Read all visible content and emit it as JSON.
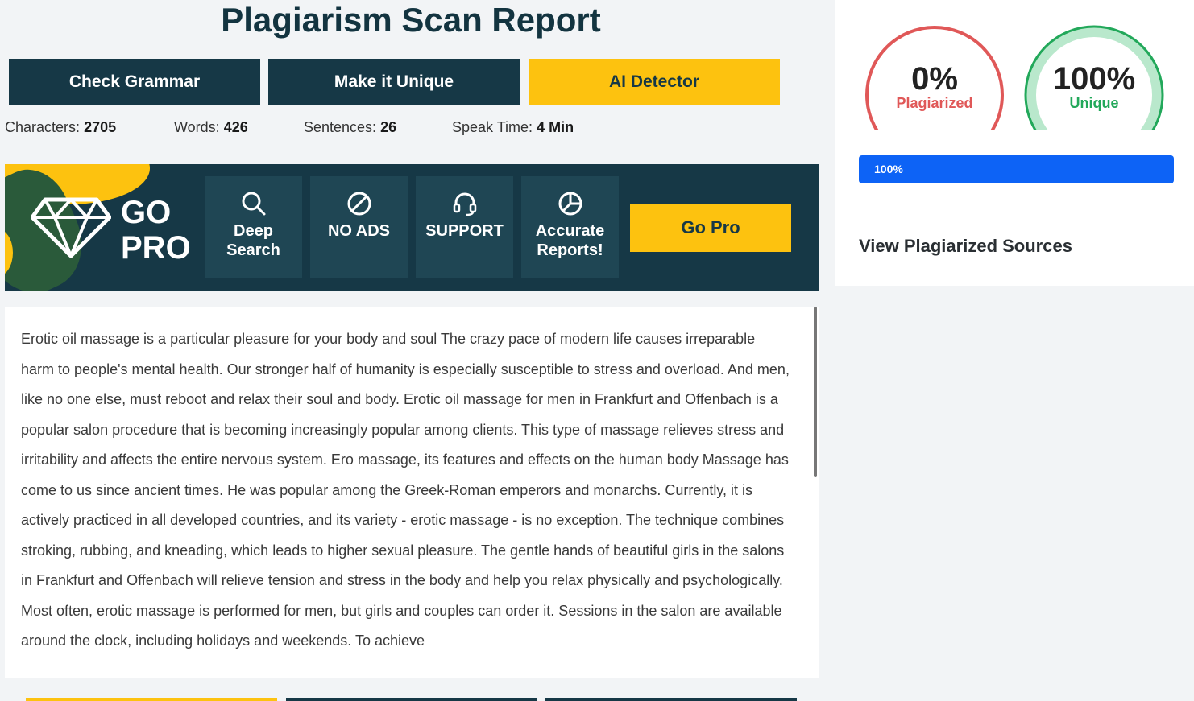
{
  "header": {
    "title": "Plagiarism Scan Report"
  },
  "actions": [
    {
      "label": "Check Grammar"
    },
    {
      "label": "Make it Unique"
    },
    {
      "label": "AI Detector"
    }
  ],
  "stats": {
    "characters_label": "Characters:",
    "characters": "2705",
    "words_label": "Words:",
    "words": "426",
    "sentences_label": "Sentences:",
    "sentences": "26",
    "speak_label": "Speak Time:",
    "speak": "4 Min"
  },
  "promo": {
    "go": "GO",
    "pro": "PRO",
    "features": [
      {
        "line1": "Deep",
        "line2": "Search",
        "icon": "search-icon"
      },
      {
        "line1": "NO ADS",
        "line2": "",
        "icon": "no-ads-icon"
      },
      {
        "line1": "SUPPORT",
        "line2": "",
        "icon": "headset-icon"
      },
      {
        "line1": "Accurate",
        "line2": "Reports!",
        "icon": "pie-chart-icon"
      }
    ],
    "button": "Go Pro"
  },
  "content": {
    "text": "Erotic oil massage is a particular pleasure for your body and soul The crazy pace of modern life causes irreparable harm to people's mental health. Our stronger half of humanity is especially susceptible to stress and overload. And men, like no one else, must reboot and relax their soul and body. Erotic oil massage for men in Frankfurt and Offenbach is a popular salon procedure that is becoming increasingly popular among clients. This type of massage relieves stress and irritability and affects the entire nervous system. Ero massage, its features and effects on the human body Massage has come to us since ancient times. He was popular among the Greek-Roman emperors and monarchs. Currently, it is actively practiced in all developed countries, and its variety - erotic massage - is no exception. The technique combines stroking, rubbing, and kneading, which leads to higher sexual pleasure. The gentle hands of beautiful girls in the salons in Frankfurt and Offenbach will relieve tension and stress in the body and help you relax physically and psychologically. Most often, erotic massage is performed for men, but girls and couples can order it. Sessions in the salon are available around the clock, including holidays and weekends. To achieve"
  },
  "results": {
    "plagiarized_value": "0%",
    "plagiarized_label": "Plagiarized",
    "plagiarized_fraction": 0,
    "unique_value": "100%",
    "unique_label": "Unique",
    "unique_fraction": 1,
    "progress_label": "100%",
    "progress_fraction": 1,
    "view_sources": "View Plagiarized Sources"
  },
  "colors": {
    "dark": "#163846",
    "yellow": "#fdc20f",
    "blue": "#0d63f6",
    "red": "#e05858",
    "green": "#22a85a"
  }
}
